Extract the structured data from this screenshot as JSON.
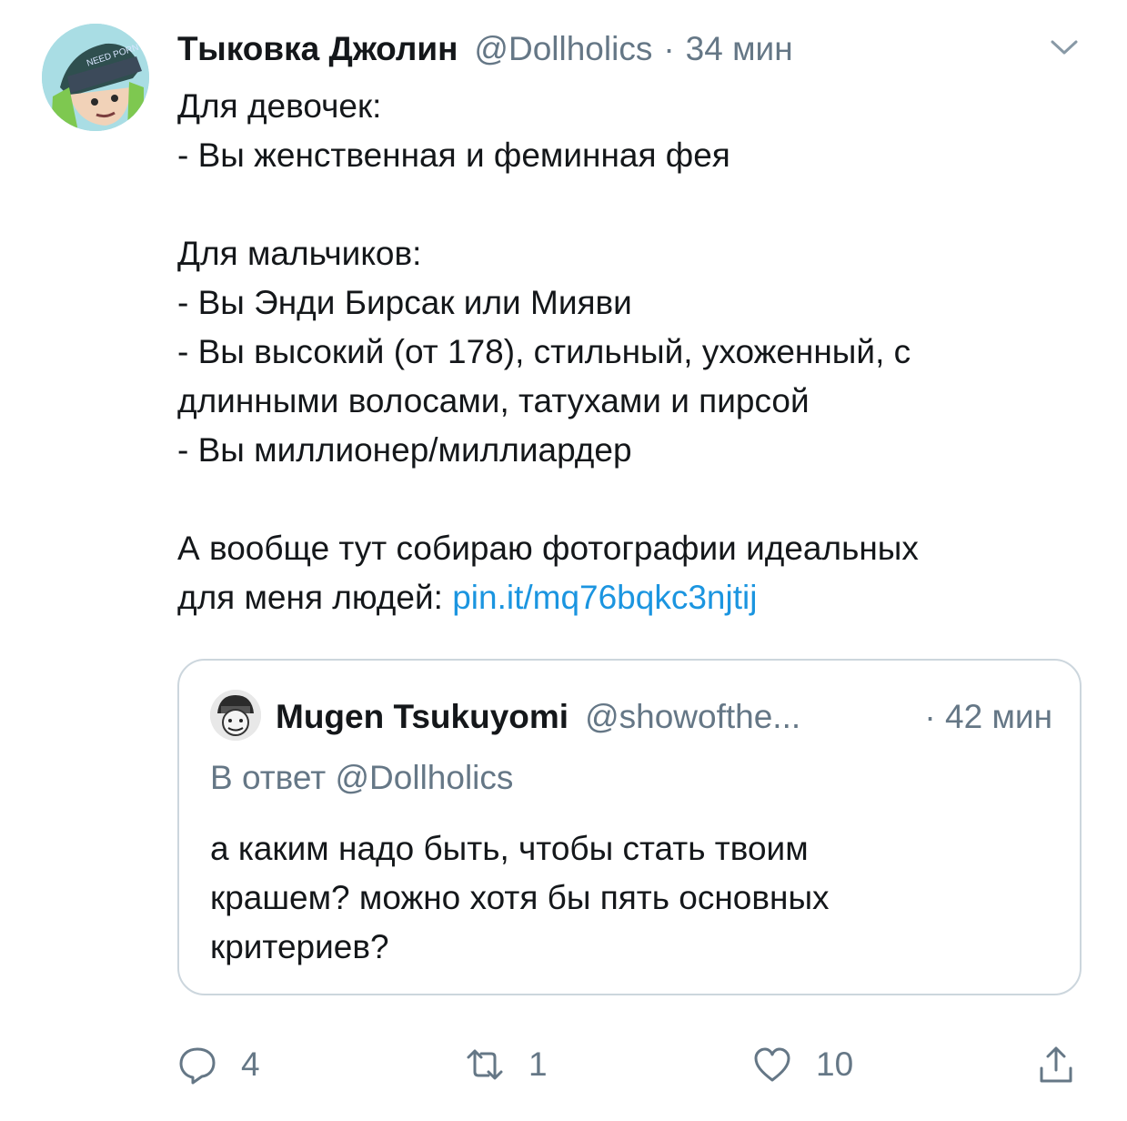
{
  "tweet": {
    "author_name": "Тыковка Джолин",
    "author_handle": "@Dollholics",
    "separator": "·",
    "time": "34 мин",
    "avatar_text": "NEED PORN",
    "lines": [
      "Для девочек:",
      "- Вы женственная и феминная фея",
      "",
      "Для мальчиков:",
      "- Вы Энди Бирсак или Мияви",
      "- Вы высокий (от 178), стильный, ухоженный, с",
      "длинными волосами, татухами и пирсой",
      "- Вы миллионер/миллиардер",
      "",
      "А вообще тут собираю фотографии идеальных"
    ],
    "last_line_prefix": "для меня людей: ",
    "link_text": "pin.it/mq76bqkc3njtij"
  },
  "quote": {
    "author_name": "Mugen Tsukuyomi",
    "author_handle": "@showofthe...",
    "time": "· 42 мин",
    "reply_to": "В ответ @Dollholics",
    "lines": [
      "а каким надо быть, чтобы стать твоим",
      "крашем? можно хотя бы пять основных",
      "критериев?"
    ]
  },
  "actions": {
    "reply_count": "4",
    "retweet_count": "1",
    "like_count": "10"
  },
  "colors": {
    "text": "#14171a",
    "secondary": "#657786",
    "link": "#1b95e0",
    "border": "#ccd6dd"
  },
  "icons": [
    "caret-down-icon",
    "reply-icon",
    "retweet-icon",
    "like-icon",
    "share-icon"
  ]
}
